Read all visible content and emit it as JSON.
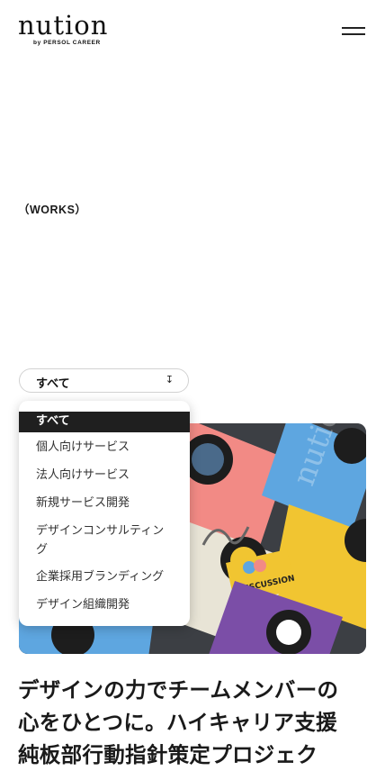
{
  "brand": {
    "name": "nution",
    "sub": "by PERSOL CAREER"
  },
  "header": {
    "menu_icon": "hamburger-icon"
  },
  "section": {
    "label": "（WORKS）"
  },
  "filter": {
    "selected": "すべて",
    "arrow_icon": "arrow-down-icon",
    "options": [
      "すべて",
      "個人向けサービス",
      "法人向けサービス",
      "新規サービス開発",
      "デザインコンサルティン",
      "グ",
      "企業採用ブランディング",
      "デザイン組織開発"
    ]
  },
  "hero": {
    "label": "DISCUSSION",
    "watermark": "nutio"
  },
  "work": {
    "title_lines": [
      "デザインの力でチームメンバーの",
      "心をひとつに。ハイキャリア支援",
      "純板部行動指針策定プロジェク"
    ]
  },
  "colors": {
    "accent": "#1f1f1f",
    "card_yellow": "#f1c531",
    "card_blue": "#5ea6e0",
    "card_pink": "#f28a85",
    "card_purple": "#7b4ea7"
  }
}
